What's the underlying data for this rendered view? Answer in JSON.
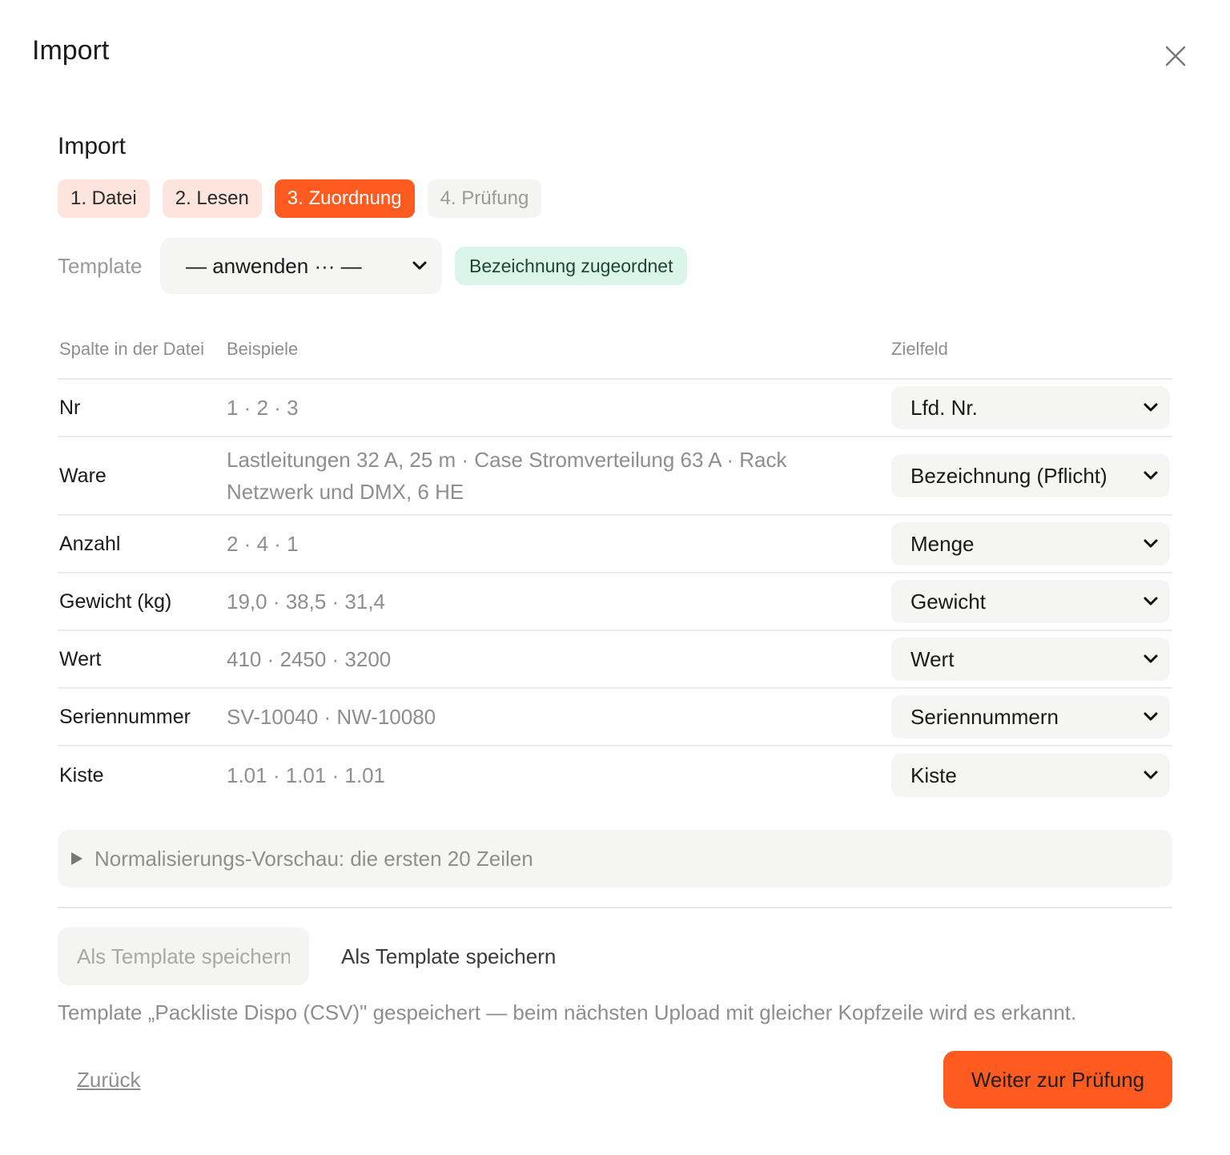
{
  "dialog": {
    "title": "Import",
    "close_icon": "close-icon"
  },
  "wizard": {
    "title": "Import",
    "steps": [
      {
        "label": "1. Datei",
        "state": "done"
      },
      {
        "label": "2. Lesen",
        "state": "done"
      },
      {
        "label": "3. Zuordnung",
        "state": "active"
      },
      {
        "label": "4. Prüfung",
        "state": "todo"
      }
    ]
  },
  "template": {
    "label": "Template",
    "selected": "— anwenden ··· —",
    "status": "Bezeichnung zugeordnet"
  },
  "mapping": {
    "headers": {
      "column": "Spalte in der Datei",
      "examples": "Beispiele",
      "target": "Zielfeld"
    },
    "rows": [
      {
        "column": "Nr",
        "examples": "1 · 2 · 3",
        "target": "Lfd. Nr."
      },
      {
        "column": "Ware",
        "examples": "Lastleitungen 32 A, 25 m · Case Stromverteilung 63 A · Rack Netzwerk und DMX, 6 HE",
        "target": "Bezeichnung (Pflicht)"
      },
      {
        "column": "Anzahl",
        "examples": "2 · 4 · 1",
        "target": "Menge"
      },
      {
        "column": "Gewicht (kg)",
        "examples": "19,0 · 38,5 · 31,4",
        "target": "Gewicht"
      },
      {
        "column": "Wert",
        "examples": "410 · 2450 · 3200",
        "target": "Wert"
      },
      {
        "column": "Seriennummer",
        "examples": "SV-10040 · NW-10080",
        "target": "Seriennummern"
      },
      {
        "column": "Kiste",
        "examples": "1.01 · 1.01 · 1.01",
        "target": "Kiste"
      }
    ]
  },
  "preview": {
    "label": "Normalisierungs-Vorschau: die ersten 20 Zeilen"
  },
  "save_template": {
    "input_placeholder": "Als Template speichern",
    "button_label": "Als Template speichern",
    "message": "Template „Packliste Dispo (CSV)\" gespeichert — beim nächsten Upload mit gleicher Kopfzeile wird es erkannt."
  },
  "footer": {
    "back_label": "Zurück",
    "next_label": "Weiter zur Prüfung"
  },
  "colors": {
    "accent": "#ff5a1f",
    "step_done_bg": "#fde4dc",
    "badge_bg": "#dcf5ea"
  }
}
